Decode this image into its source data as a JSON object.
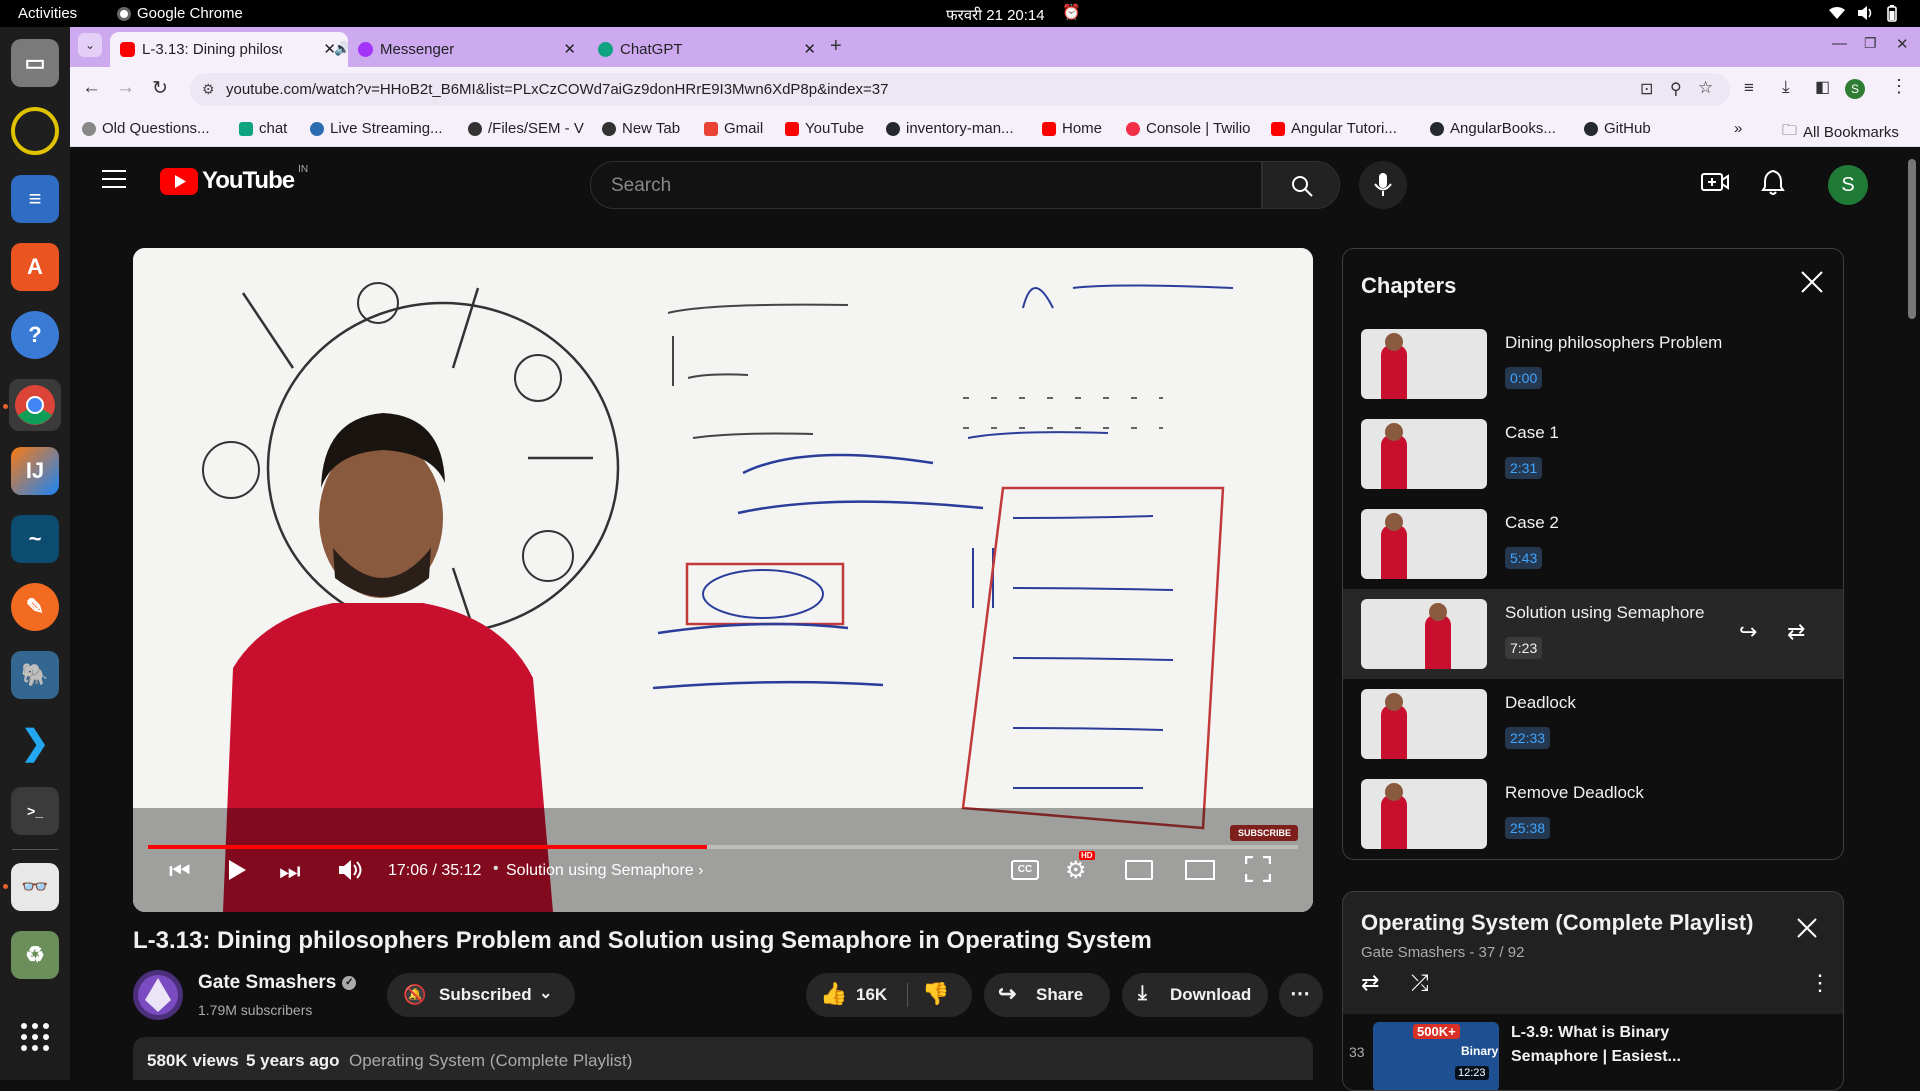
{
  "topbar": {
    "activities": "Activities",
    "app": "Google Chrome",
    "datetime": "फरवरी 21  20:14"
  },
  "chrome": {
    "tabs": [
      {
        "label": "L-3.13: Dining philoso",
        "favicon_color": "#ff0000"
      },
      {
        "label": "Messenger",
        "favicon_color": "#a334fa"
      },
      {
        "label": "ChatGPT",
        "favicon_color": "#10a37f"
      }
    ],
    "url": "youtube.com/watch?v=HHoB2t_B6MI&list=PLxCzCOWd7aiGz9donHRrE9I3Mwn6XdP8p&index=37",
    "bookmarks": [
      {
        "label": "Old Questions...",
        "color": "#888888"
      },
      {
        "label": "chat",
        "color": "#10a37f"
      },
      {
        "label": "Live Streaming...",
        "color": "#2b6cb0"
      },
      {
        "label": "/Files/SEM - V",
        "color": "#333333"
      },
      {
        "label": "New Tab",
        "color": "#333333"
      },
      {
        "label": "Gmail",
        "color": "#ea4335"
      },
      {
        "label": "YouTube",
        "color": "#ff0000"
      },
      {
        "label": "inventory-man...",
        "color": "#24292e"
      },
      {
        "label": "Home",
        "color": "#ff0000"
      },
      {
        "label": "Console | Twilio",
        "color": "#f22f46"
      },
      {
        "label": "Angular Tutori...",
        "color": "#ff0000"
      },
      {
        "label": "AngularBooks...",
        "color": "#24292e"
      },
      {
        "label": "GitHub",
        "color": "#24292e"
      }
    ],
    "all_bookmarks": "All Bookmarks",
    "profile_initial": "S"
  },
  "youtube": {
    "logo_text": "YouTube",
    "logo_region": "IN",
    "search_placeholder": "Search",
    "avatar_initial": "S",
    "player": {
      "time": "17:06 / 35:12",
      "chapter": "Solution using Semaphore",
      "progress": 0.486,
      "hd_badge": "HD",
      "subscribe_badge": "SUBSCRIBE"
    },
    "video_title": "L-3.13: Dining philosophers Problem and Solution using Semaphore in Operating System",
    "channel": {
      "name": "Gate Smashers",
      "subscribers": "1.79M subscribers"
    },
    "subscribed_label": "Subscribed",
    "likes": "16K",
    "share_label": "Share",
    "download_label": "Download",
    "meta": {
      "views": "580K views",
      "age": "5 years ago",
      "playlist_link": "Operating System (Complete Playlist)"
    },
    "chapters_title": "Chapters",
    "chapters": [
      {
        "title": "Dining philosophers Problem",
        "time": "0:00"
      },
      {
        "title": "Case 1",
        "time": "2:31"
      },
      {
        "title": "Case 2",
        "time": "5:43"
      },
      {
        "title": "Solution using Semaphore",
        "time": "7:23",
        "active": true
      },
      {
        "title": "Deadlock",
        "time": "22:33"
      },
      {
        "title": "Remove Deadlock",
        "time": "25:38"
      }
    ],
    "playlist": {
      "title": "Operating System (Complete Playlist)",
      "subtitle": "Gate Smashers - 37 / 92",
      "first_item": {
        "index": "33",
        "title_line1": "L-3.9: What is Binary",
        "title_line2": "Semaphore | Easiest...",
        "thumb_badge": "500K+",
        "thumb_text": "Binary",
        "duration": "12:23"
      }
    }
  }
}
